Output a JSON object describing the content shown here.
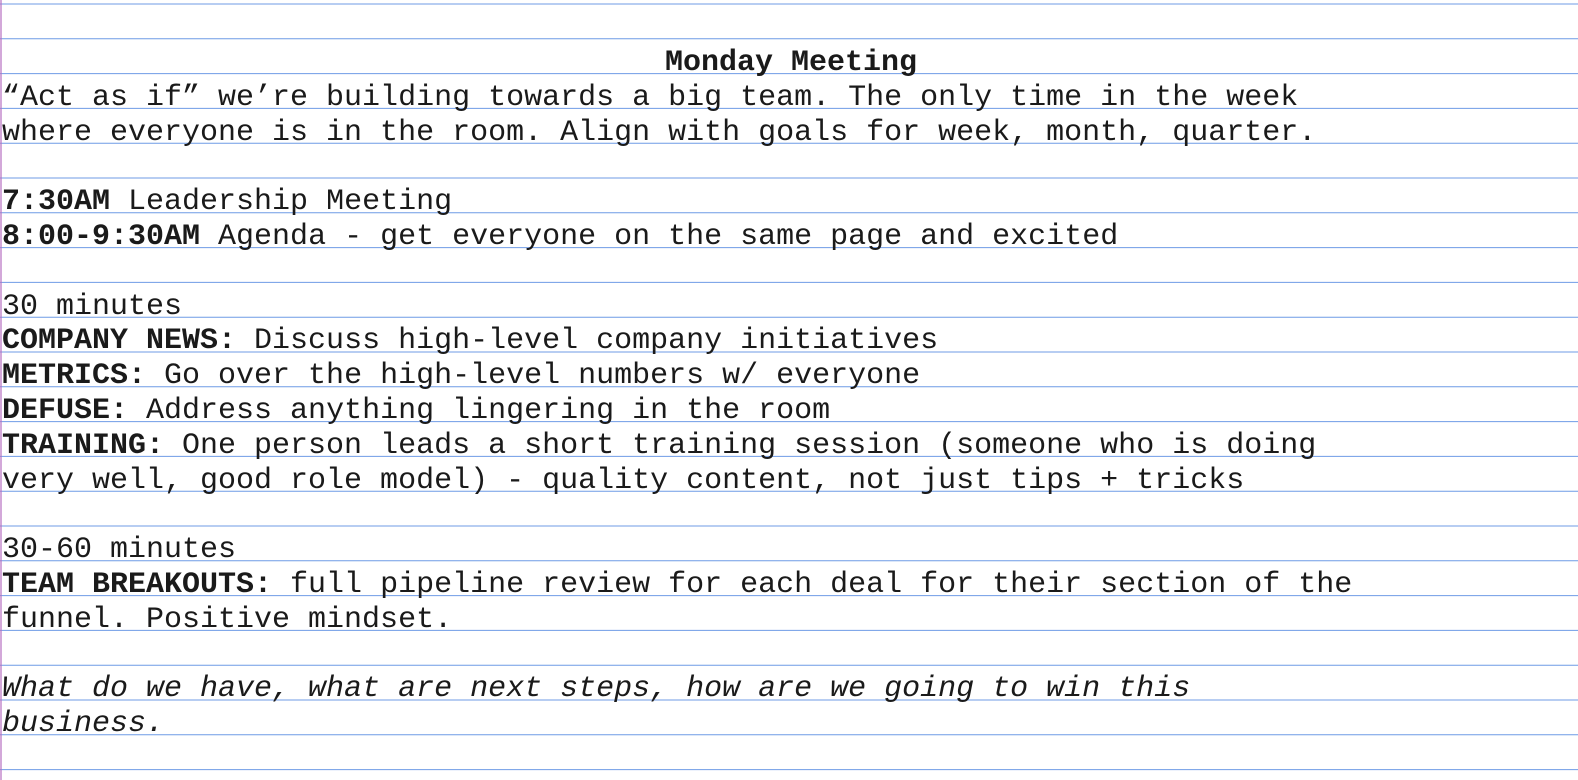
{
  "title": "Monday Meeting",
  "intro": [
    "“Act as if” we’re building towards a big team. The only time in the week",
    "where everyone is in the room. Align with goals for week, month, quarter."
  ],
  "schedule": [
    {
      "time": "7:30AM",
      "text": " Leadership Meeting"
    },
    {
      "time": "8:00-9:30AM",
      "text": " Agenda - get everyone on the same page and excited"
    }
  ],
  "section1": {
    "duration": "30 minutes",
    "items": [
      {
        "label": "COMPANY NEWS:",
        "text": " Discuss high-level company initiatives"
      },
      {
        "label": "METRICS:",
        "text": " Go over the high-level numbers w/ everyone"
      },
      {
        "label": "DEFUSE:",
        "text": " Address anything lingering in the room"
      },
      {
        "label": "TRAINING:",
        "text": " One person leads a short training session (someone who is doing"
      }
    ],
    "training_continued": "very well, good role model) - quality content, not just tips + tricks"
  },
  "section2": {
    "duration": "30-60 minutes",
    "label": "TEAM BREAKOUTS:",
    "text": " full pipeline review for each deal for their section of the",
    "continued": "funnel. Positive mindset."
  },
  "closing": [
    "What do we have, what are next steps, how are we going to win this",
    "business."
  ],
  "colors": {
    "rule_line": "#6f9be6",
    "margin_line": "#b66fc0",
    "text": "#1a1a1a"
  }
}
